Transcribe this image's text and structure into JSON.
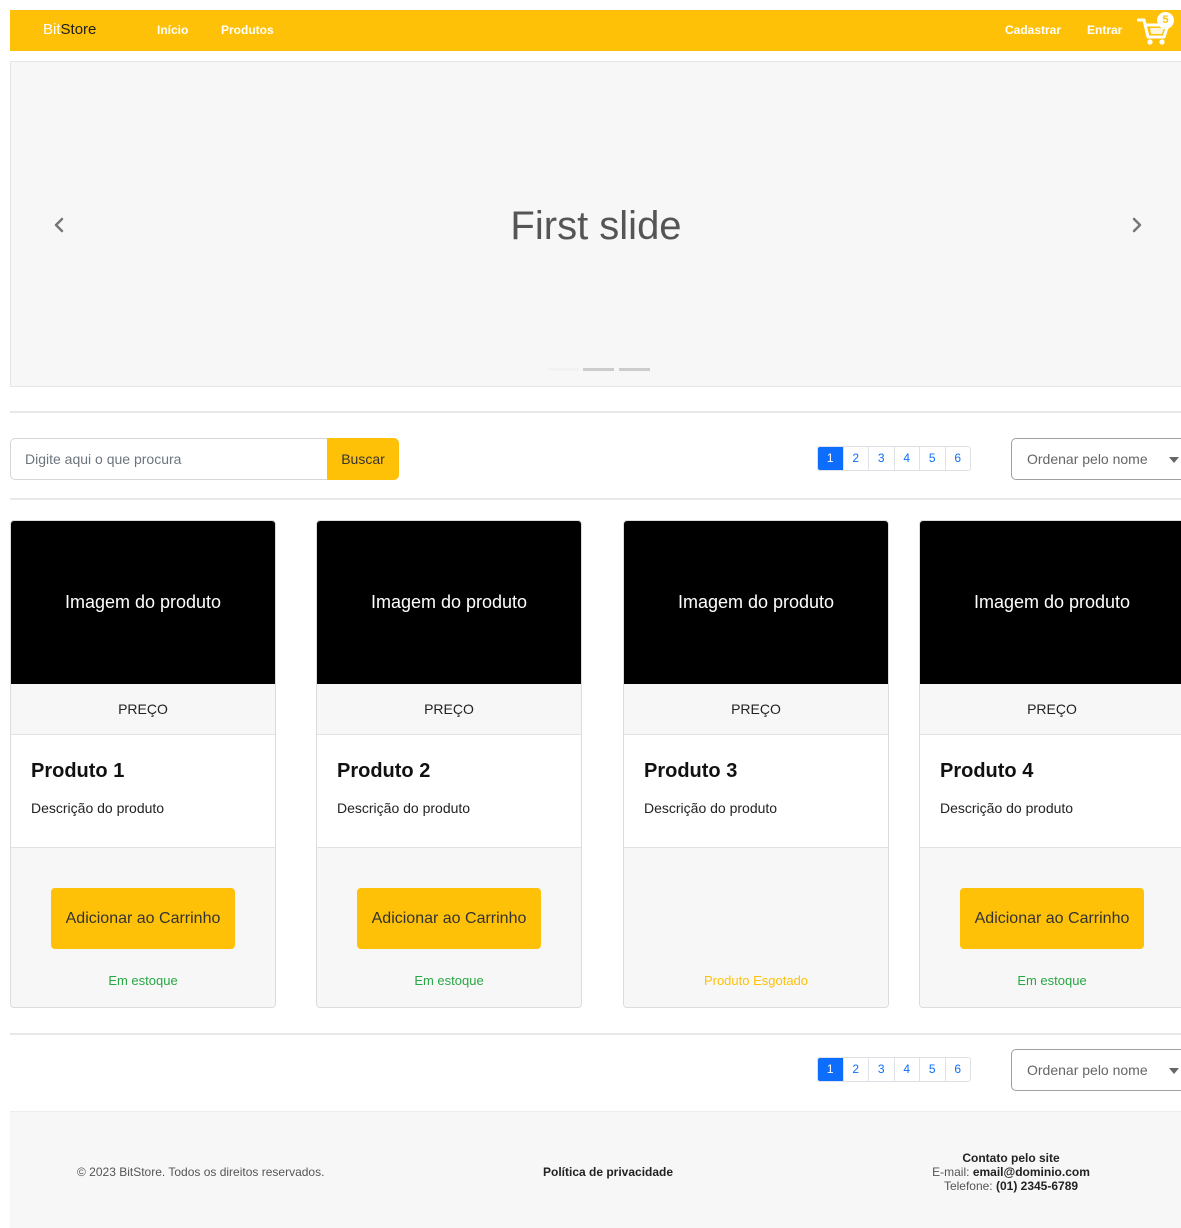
{
  "navbar": {
    "brand_part1": "Bit",
    "brand_part2": "Store",
    "links": [
      "Início",
      "Produtos"
    ],
    "register_label": "Cadastrar",
    "login_label": "Entrar",
    "cart_count": "5",
    "background": "#ffc107"
  },
  "carousel": {
    "slide_title": "First slide",
    "slide_count": 3,
    "active_slide": 1
  },
  "search": {
    "placeholder": "Digite aqui o que procura",
    "button_label": "Buscar"
  },
  "pagination": {
    "pages": [
      "1",
      "2",
      "3",
      "4",
      "5",
      "6"
    ],
    "active": "1"
  },
  "sort": {
    "selected": "Ordenar pelo nome"
  },
  "products": [
    {
      "image_label": "Imagem do produto",
      "price_label": "PREÇO",
      "name": "Produto 1",
      "description": "Descrição do produto",
      "button_label": "Adicionar ao Carrinho",
      "stock_label": "Em estoque",
      "in_stock": true
    },
    {
      "image_label": "Imagem do produto",
      "price_label": "PREÇO",
      "name": "Produto 2",
      "description": "Descrição do produto",
      "button_label": "Adicionar ao Carrinho",
      "stock_label": "Em estoque",
      "in_stock": true
    },
    {
      "image_label": "Imagem do produto",
      "price_label": "PREÇO",
      "name": "Produto 3",
      "description": "Descrição do produto",
      "button_label": "",
      "stock_label": "Produto Esgotado",
      "in_stock": false
    },
    {
      "image_label": "Imagem do produto",
      "price_label": "PREÇO",
      "name": "Produto 4",
      "description": "Descrição do produto",
      "button_label": "Adicionar ao Carrinho",
      "stock_label": "Em estoque",
      "in_stock": true
    }
  ],
  "footer": {
    "copyright": "© 2023 BitStore. Todos os direitos reservados.",
    "privacy": "Política de privacidade",
    "contact_title": "Contato pelo site",
    "email_label": "E-mail:",
    "email": "email@dominio.com",
    "phone_label": "Telefone:",
    "phone": "(01) 2345-6789"
  },
  "colors": {
    "accent": "#ffc107",
    "in_stock": "#28a745",
    "out_of_stock": "#ffc107",
    "page_active": "#0d6efd"
  }
}
